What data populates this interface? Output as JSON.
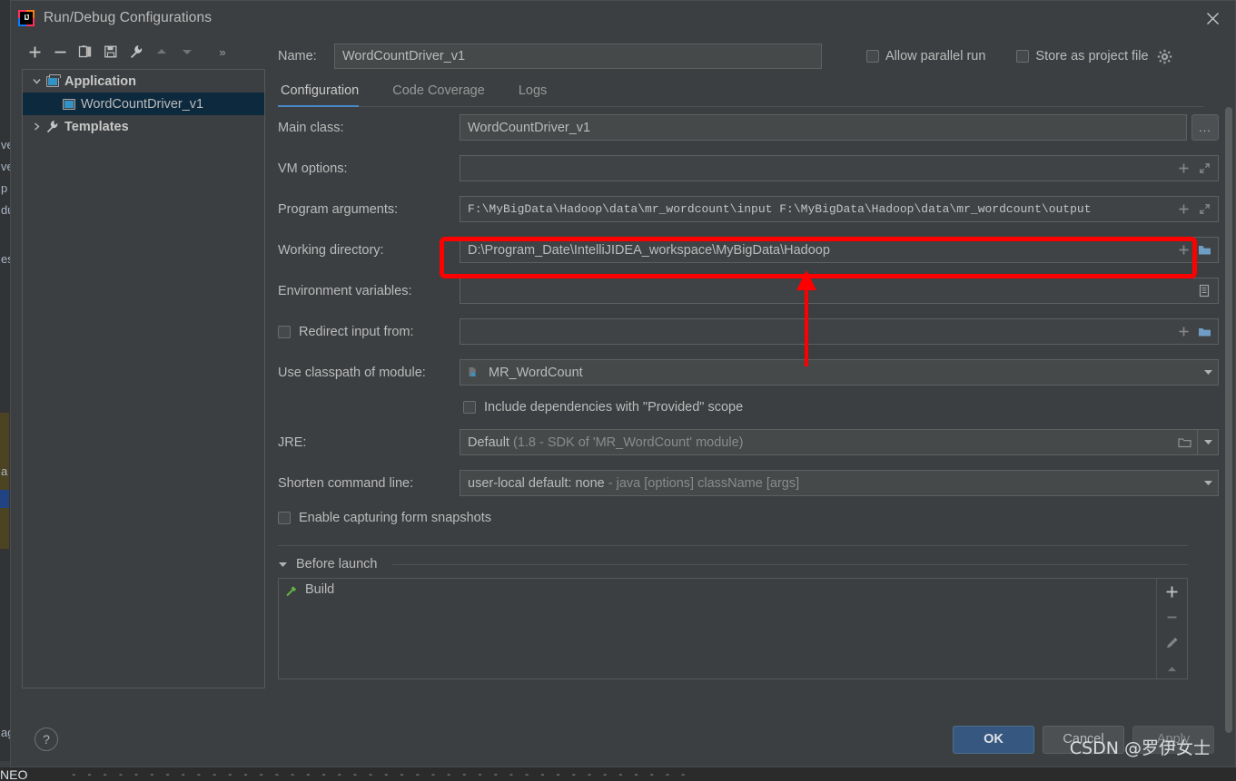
{
  "window": {
    "title": "Run/Debug Configurations",
    "app_icon": "intellij-idea-icon",
    "close_icon": "close-icon"
  },
  "sidebar": {
    "toolbar": [
      {
        "name": "add-configuration-button",
        "icon": "plus-icon",
        "label": "+"
      },
      {
        "name": "remove-configuration-button",
        "icon": "minus-icon",
        "label": "−"
      },
      {
        "name": "copy-configuration-button",
        "icon": "copy-icon",
        "label": ""
      },
      {
        "name": "save-configuration-button",
        "icon": "save-icon",
        "label": ""
      },
      {
        "name": "edit-templates-button",
        "icon": "wrench-icon",
        "label": ""
      },
      {
        "name": "move-up-button",
        "icon": "arrow-up-icon",
        "label": ""
      },
      {
        "name": "move-down-button",
        "icon": "arrow-down-icon",
        "label": ""
      }
    ],
    "more_label": "»",
    "tree": [
      {
        "label": "Application",
        "icon": "application-group-icon",
        "expanded": true,
        "selected": false,
        "depth": 0,
        "bold": true
      },
      {
        "label": "WordCountDriver_v1",
        "icon": "application-config-icon",
        "expanded": null,
        "selected": true,
        "depth": 1,
        "bold": false
      },
      {
        "label": "Templates",
        "icon": "wrench-icon",
        "expanded": false,
        "selected": false,
        "depth": 0,
        "bold": true
      }
    ]
  },
  "header": {
    "name_label": "Name:",
    "name_value": "WordCountDriver_v1",
    "allow_parallel_run": {
      "label": "Allow parallel run",
      "checked": false
    },
    "store_as_project_file": {
      "label": "Store as project file",
      "checked": false
    },
    "gear_icon": "gear-icon"
  },
  "tabs": [
    {
      "label": "Configuration",
      "active": true
    },
    {
      "label": "Code Coverage",
      "active": false
    },
    {
      "label": "Logs",
      "active": false
    }
  ],
  "form": {
    "main_class": {
      "label": "Main class:",
      "value": "WordCountDriver_v1",
      "browse_label": "..."
    },
    "vm_options": {
      "label": "VM options:",
      "value": "",
      "placeholder": ""
    },
    "program_arguments": {
      "label": "Program arguments:",
      "value": "F:\\MyBigData\\Hadoop\\data\\mr_wordcount\\input F:\\MyBigData\\Hadoop\\data\\mr_wordcount\\output"
    },
    "working_directory": {
      "label": "Working directory:",
      "value": "D:\\Program_Date\\IntelliJIDEA_workspace\\MyBigData\\Hadoop"
    },
    "environment_variables": {
      "label": "Environment variables:",
      "value": ""
    },
    "redirect_input_from": {
      "label": "Redirect input from:",
      "value": "",
      "checked": false
    },
    "use_classpath_of_module": {
      "label": "Use classpath of module:",
      "value": "MR_WordCount",
      "icon": "module-icon"
    },
    "include_provided_scope": {
      "label": "Include dependencies with \"Provided\" scope",
      "checked": false
    },
    "jre": {
      "label": "JRE:",
      "value": "Default",
      "value_hint": "(1.8 - SDK of 'MR_WordCount' module)"
    },
    "shorten_command_line": {
      "label": "Shorten command line:",
      "value": "user-local default: none",
      "value_hint": "- java [options] className [args]"
    },
    "enable_form_snapshots": {
      "label": "Enable capturing form snapshots",
      "checked": false
    }
  },
  "before_launch": {
    "title": "Before launch",
    "expanded": true,
    "items": [
      {
        "label": "Build",
        "icon": "hammer-icon"
      }
    ],
    "actions": [
      {
        "name": "add-task-button",
        "icon": "plus-icon"
      },
      {
        "name": "remove-task-button",
        "icon": "minus-icon"
      },
      {
        "name": "edit-task-button",
        "icon": "pencil-icon"
      },
      {
        "name": "move-task-up-button",
        "icon": "arrow-up-icon"
      }
    ]
  },
  "footer": {
    "help_label": "?",
    "ok_label": "OK",
    "cancel_label": "Cancel",
    "apply_label": "Apply"
  },
  "annotation": {
    "highlight_color": "#fe0000",
    "arrow_color": "#fe0000",
    "target": "program-arguments-field"
  },
  "watermark": {
    "text": "CSDN @罗伊女士"
  },
  "background": {
    "editor_fragments": [
      "ve",
      "ve",
      "p",
      "du",
      "es",
      "a",
      "ag",
      "N",
      "N",
      "NEO"
    ],
    "statusline_neo": "NEO",
    "statusline_dashes": "- - - - - - - - - - - - - - - - - - - - - - - - - - - - - - - - - - - - - - - -"
  },
  "colors": {
    "dialog_bg": "#3c3f41",
    "input_bg": "#45494a",
    "accent": "#4a88c7",
    "selection": "#0d293e",
    "primary_button": "#365880",
    "text": "#bbbbbb",
    "annotation_red": "#fe0000"
  }
}
